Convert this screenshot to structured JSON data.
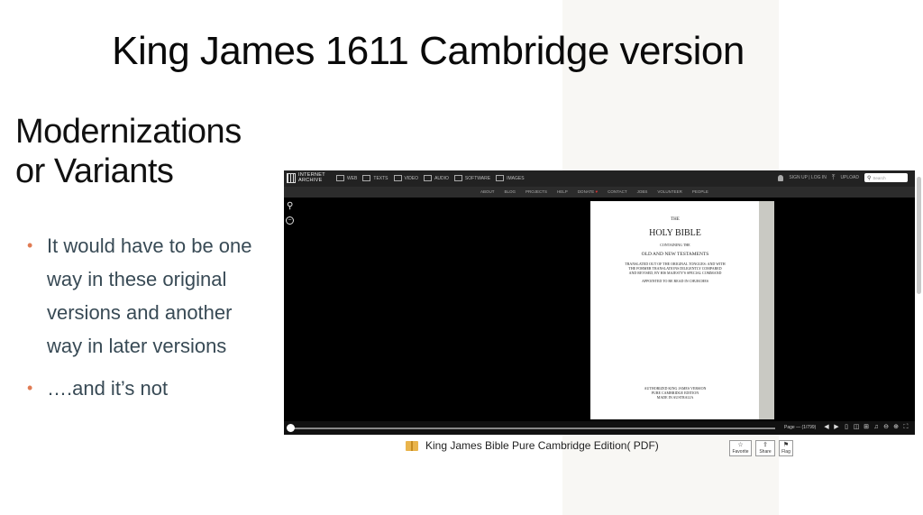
{
  "slide": {
    "title": "King James 1611 Cambridge version",
    "subtitle_line1": "Modernizations",
    "subtitle_line2": "or Variants",
    "bullets": [
      "It would have to be one way in these original versions and another way in later versions",
      "….and it’s not"
    ],
    "accent_color": "#e07b53"
  },
  "archive": {
    "logo_line1": "INTERNET",
    "logo_line2": "ARCHIVE",
    "nav": [
      {
        "label": "WEB",
        "icon": "web-icon"
      },
      {
        "label": "TEXTS",
        "icon": "texts-icon"
      },
      {
        "label": "VIDEO",
        "icon": "video-icon"
      },
      {
        "label": "AUDIO",
        "icon": "audio-icon"
      },
      {
        "label": "SOFTWARE",
        "icon": "software-icon"
      },
      {
        "label": "IMAGES",
        "icon": "images-icon"
      }
    ],
    "sign_in": "SIGN UP | LOG IN",
    "upload": "UPLOAD",
    "search_placeholder": "Search",
    "subnav": [
      "ABOUT",
      "BLOG",
      "PROJECTS",
      "HELP",
      "DONATE",
      "CONTACT",
      "JOBS",
      "VOLUNTEER",
      "PEOPLE"
    ],
    "donate_heart": "♥",
    "book_page": {
      "line1": "THE",
      "line2": "HOLY BIBLE",
      "line3": "CONTAINING THE",
      "line4": "OLD AND NEW TESTAMENTS",
      "line5a": "TRANSLATED OUT OF THE ORIGINAL TONGUES: AND WITH",
      "line5b": "THE FORMER TRANSLATIONS DILIGENTLY COMPARED",
      "line5c": "AND REVISED, BY HIS MAJESTY'S SPECIAL COMMAND",
      "line6": "APPOINTED TO BE READ IN CHURCHES",
      "line7a": "AUTHORIZED KING JAMES VERSION",
      "line7b": "PURE CAMBRIDGE EDITION",
      "line7c": "MADE IN AUSTRALIA"
    },
    "page_indicator": "Page — (1/799)"
  },
  "caption": {
    "title": "King James Bible Pure Cambridge Edition( PDF)",
    "favorite": "Favorite",
    "share": "Share",
    "flag": "Flag"
  }
}
